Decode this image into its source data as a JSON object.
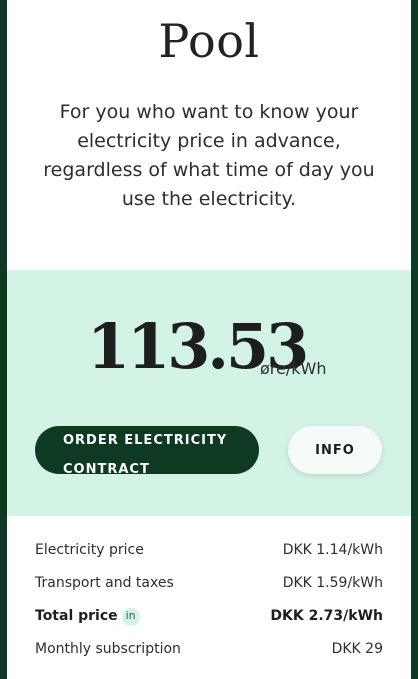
{
  "product": {
    "title": "Pool",
    "description": "For you who want to know your electricity price in advance, regardless of what time of day you use the electricity."
  },
  "price": {
    "value": "113.53",
    "unit": "øre/kWh"
  },
  "buttons": {
    "order_label": "ORDER ELECTRICITY CONTRACT",
    "info_label": "INFO"
  },
  "breakdown": [
    {
      "label": "Electricity price",
      "value": "DKK 1.14/kWh"
    },
    {
      "label": "Transport and taxes",
      "value": "DKK 1.59/kWh"
    },
    {
      "label": "Total price",
      "value": "DKK 2.73/kWh",
      "info_icon": "in"
    },
    {
      "label": "Monthly subscription",
      "value": "DKK 29"
    }
  ],
  "colors": {
    "brand_dark": "#0e3a24",
    "mint": "#d3f3e5"
  }
}
